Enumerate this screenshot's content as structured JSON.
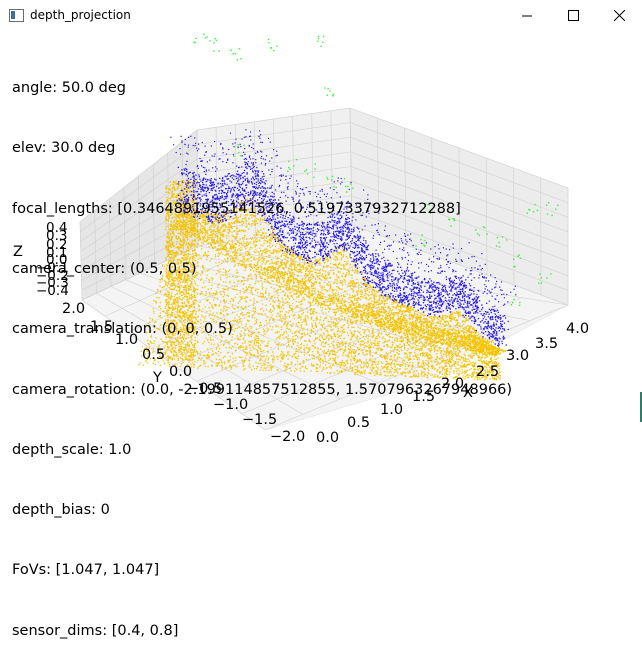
{
  "window": {
    "title": "depth_projection",
    "icon": "window-icon",
    "controls": [
      "minimize-icon",
      "maximize-icon",
      "close-icon"
    ]
  },
  "overlay": {
    "lines": [
      "angle: 50.0 deg",
      "elev: 30.0 deg",
      "focal_lengths: [0.3464891955141526, 0.5197337932712288]",
      "camera_center: (0.5, 0.5)",
      "camera_translation: (0, 0, 0.5)",
      "camera_rotation: (0.0, -2.199114857512855, 1.5707963267948966)",
      "depth_scale: 1.0",
      "depth_bias: 0",
      "FoVs: [1.047, 1.047]",
      "sensor_dims: [0.4, 0.8]"
    ]
  },
  "axes": {
    "x_label": "X",
    "y_label": "Y",
    "z_label": "Z",
    "x_ticks": [
      "0.0",
      "0.5",
      "1.0",
      "1.5",
      "2.0",
      "2.5",
      "3.0",
      "3.5",
      "4.0"
    ],
    "y_ticks": [
      "2.0",
      "1.5",
      "1.0",
      "0.5",
      "0.0",
      "−0.5",
      "−1.0",
      "−1.5",
      "−2.0"
    ],
    "z_ticks": [
      "0.4",
      "0.3",
      "0.2",
      "0.1",
      "0.0",
      "−0.1",
      "−0.2",
      "−0.3",
      "−0.4"
    ]
  },
  "colors": {
    "floor_points": "#f5c400",
    "wall_points": "#2b1fe0",
    "green_points": "#3df03d",
    "pane": "#f2f2f2",
    "grid": "#d0d0d0"
  }
}
